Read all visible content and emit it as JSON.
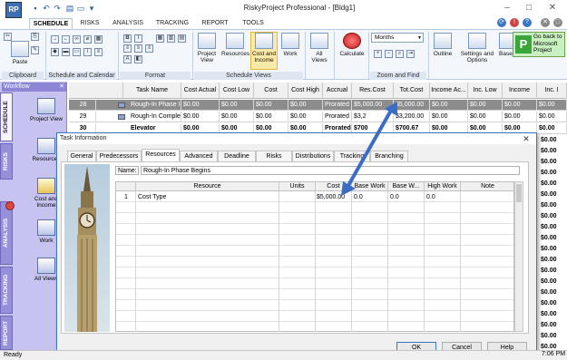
{
  "app": {
    "title": "RiskyProject Professional - [Bldg1]",
    "logo_text": "RP",
    "back_button": "Go back to Microsoft Project",
    "back_icon_letter": "P"
  },
  "quick_access": [
    "save-icon",
    "undo-icon",
    "redo-icon",
    "print-icon",
    "open-folder-icon",
    "dropdown-icon"
  ],
  "window_controls": {
    "minimize": "–",
    "maximize": "□",
    "close": "✕"
  },
  "ribbon_tabs": [
    "SCHEDULE",
    "RISKS",
    "ANALYSIS",
    "TRACKING",
    "REPORT",
    "TOOLS"
  ],
  "ribbon": {
    "paste": "Paste",
    "project_view": "Project View",
    "resources": "Resources",
    "cost_income": "Cost and Income",
    "work": "Work",
    "all_views": "All Views",
    "calculate": "Calculate",
    "months": "Months",
    "outline": "Outline",
    "settings_options": "Settings and Options",
    "baseline": "Base...",
    "groups": {
      "clipboard": "Clipboard",
      "schedule_calendar": "Schedule and Calendar",
      "format": "Format",
      "schedule_views": "Schedule Views",
      "zoom_find": "Zoom and Find"
    }
  },
  "workflow": {
    "header": "Workflow",
    "close": "✕",
    "tabs": [
      "SCHEDULE",
      "RISKS",
      "ANALYSIS",
      "TRACKING",
      "REPORT"
    ],
    "items": [
      "Project View",
      "Resources",
      "Cost and Income",
      "Work",
      "All Views"
    ]
  },
  "task_grid": {
    "columns": [
      "Task Name",
      "Cost Actual",
      "Cost Low",
      "Cost",
      "Cost High",
      "Accrual",
      "Res.Cost",
      "Tot.Cost",
      "Income Ac...",
      "Inc. Low",
      "Income",
      "Inc. I"
    ],
    "rows": [
      {
        "id": "28",
        "name": "Rough-In Phase I",
        "cost_actual": "$0.00",
        "cost_low": "$0.00",
        "cost": "$0.00",
        "cost_high": "$0.00",
        "accrual": "Prorated",
        "res_cost": "$5,000.00",
        "tot_cost": "$5,000.00",
        "income_ac": "$0.00",
        "inc_low": "$0.00",
        "income": "$0.00",
        "inc_i": "$0.00"
      },
      {
        "id": "29",
        "name": "Rough-In Comple",
        "cost_actual": "$0.00",
        "cost_low": "$0.00",
        "cost": "$0.00",
        "cost_high": "$0.00",
        "accrual": "Prorated",
        "res_cost": "$3,2",
        "tot_cost": "$3,200.00",
        "income_ac": "$0.00",
        "inc_low": "$0.00",
        "income": "$0.00",
        "inc_i": "$0.00"
      },
      {
        "id": "30",
        "name": "Elevator",
        "cost_actual": "$0.00",
        "cost_low": "$0.00",
        "cost": "$0.00",
        "cost_high": "$0.00",
        "accrual": "Prorated",
        "res_cost": "$700",
        "tot_cost": "$700.67",
        "income_ac": "$0.00",
        "inc_low": "$0.00",
        "income": "$0.00",
        "inc_i": "$0.00"
      }
    ],
    "right_edge_values": [
      "$0.00",
      "$0.00",
      "$0.00",
      "$0.00",
      "$0.00",
      "$0.00",
      "$0.00",
      "$0.00",
      "$0.00",
      "$0.00",
      "$0.00",
      "$0.00",
      "$0.00",
      "$0.00",
      "$0.00",
      "$0.00",
      "$0.00",
      "$0.00",
      "$0.00",
      "$0.00"
    ]
  },
  "dialog": {
    "title": "Task Information",
    "close": "✕",
    "tabs": [
      "General",
      "Predecessors",
      "Resources",
      "Advanced",
      "Deadline",
      "Risks",
      "Distributions",
      "Tracking",
      "Branching"
    ],
    "active_tab": "Resources",
    "name_label": "Name:",
    "name_value": "Rough-In Phase Begins",
    "columns": [
      "Resource",
      "Units",
      "Cost",
      "Base Work",
      "Base W...",
      "High Work",
      "Note"
    ],
    "rows": [
      {
        "num": "1",
        "resource": "Cost Type",
        "units": "",
        "cost": "$5,000.00",
        "base_work": "0.0",
        "base_w2": "0.0",
        "high_work": "0.0",
        "note": ""
      }
    ],
    "buttons": {
      "ok": "OK",
      "cancel": "Cancel",
      "help": "Help"
    }
  },
  "status": {
    "text": "Ready",
    "time": "7:06 PM"
  },
  "colors": {
    "accent": "#3a76c4",
    "workflow_bg": "#c7c3f0",
    "selected_row": "#8c8c8c",
    "arrow": "#3b6dc4"
  }
}
